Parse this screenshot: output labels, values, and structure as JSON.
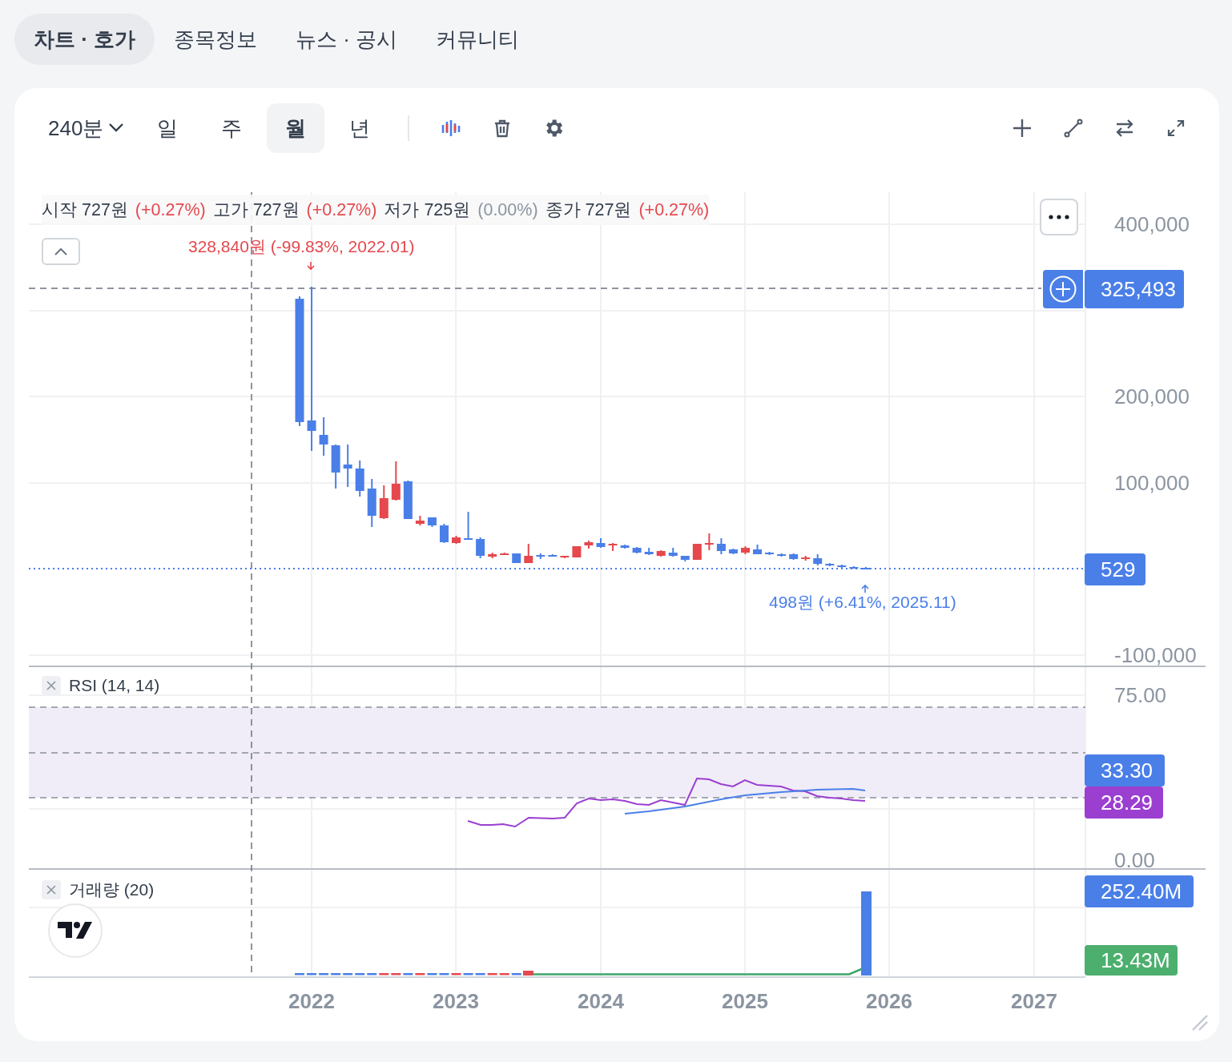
{
  "tabs": [
    {
      "label": "차트 · 호가",
      "selected": true
    },
    {
      "label": "종목정보",
      "selected": false
    },
    {
      "label": "뉴스 · 공시",
      "selected": false
    },
    {
      "label": "커뮤니티",
      "selected": false
    }
  ],
  "toolbar": {
    "interval": "240분",
    "periods": [
      {
        "label": "일",
        "selected": false
      },
      {
        "label": "주",
        "selected": false
      },
      {
        "label": "월",
        "selected": true
      },
      {
        "label": "년",
        "selected": false
      }
    ]
  },
  "legend": [
    {
      "label": "시작",
      "value": "727원",
      "change": "(+0.27%)",
      "color": "#e5484d"
    },
    {
      "label": "고가",
      "value": "727원",
      "change": "(+0.27%)",
      "color": "#e5484d"
    },
    {
      "label": "저가",
      "value": "725원",
      "change": "(0.00%)",
      "color": "#8b95a1"
    },
    {
      "label": "종가",
      "value": "727원",
      "change": "(+0.27%)",
      "color": "#e5484d"
    }
  ],
  "annotations": {
    "high": "328,840원 (-99.83%, 2022.01)",
    "low": "498원 (+6.41%, 2025.11)"
  },
  "price_axis": {
    "ticks": [
      "400,000",
      "200,000",
      "100,000",
      "-100,000"
    ],
    "crosshair_price": "325,493",
    "last_price": "529"
  },
  "rsi": {
    "title": "RSI (14, 14)",
    "ticks": [
      "75.00",
      "0.00"
    ],
    "signal_value": "33.30",
    "rsi_value": "28.29"
  },
  "volume": {
    "title": "거래량 (20)",
    "value": "252.40M",
    "ma_value": "13.43M"
  },
  "x_axis": {
    "ticks": [
      "2022",
      "2023",
      "2024",
      "2025",
      "2026",
      "2027"
    ]
  }
}
